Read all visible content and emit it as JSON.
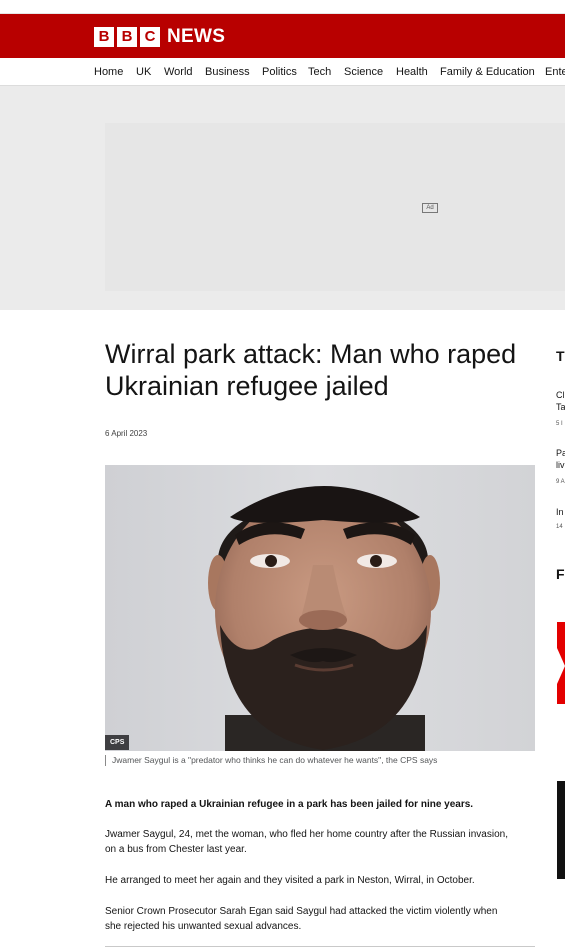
{
  "header": {
    "logo_letters": [
      "B",
      "B",
      "C"
    ],
    "logo_text": "NEWS"
  },
  "nav": {
    "items": [
      "Home",
      "UK",
      "World",
      "Business",
      "Politics",
      "Tech",
      "Science",
      "Health",
      "Family & Education",
      "Ente"
    ]
  },
  "ad": {
    "label": "Ad"
  },
  "article": {
    "headline": "Wirral park attack: Man who raped Ukrainian refugee jailed",
    "date": "6 April 2023",
    "image_credit": "CPS",
    "image_caption": "Jwamer Saygul is a \"predator who thinks he can do whatever he wants\", the CPS says",
    "paragraphs": [
      "A man who raped a Ukrainian refugee in a park has been jailed for nine years.",
      "Jwamer Saygul, 24, met the woman, who fled her home country after the Russian invasion, on a bus from Chester last year.",
      "He arranged to meet her again and they visited a park in Neston, Wirral, in October.",
      "Senior Crown Prosecutor Sarah Egan said Saygul had attacked the victim violently when she rejected his unwanted sexual advances."
    ]
  },
  "sidebar": {
    "section_title": "T",
    "items": [
      {
        "line1": "Cl",
        "line2": "Ta",
        "date": "5 I"
      },
      {
        "line1": "Pa",
        "line2": "liv",
        "date": "9 A"
      },
      {
        "line1": "In",
        "line2": "",
        "date": "14"
      }
    ],
    "section_title_2": "F"
  },
  "colors": {
    "brand_red": "#b80000",
    "background": "#ffffff",
    "ad_background": "#ebebeb"
  }
}
